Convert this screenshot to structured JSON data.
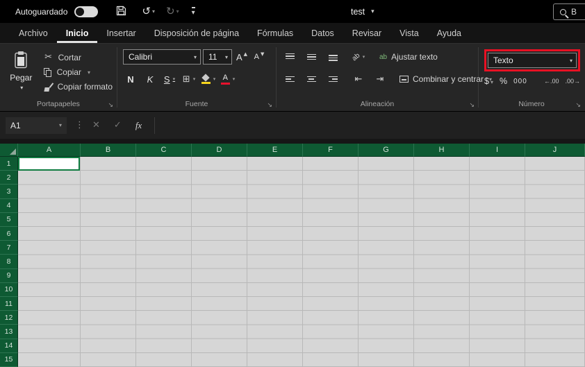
{
  "titlebar": {
    "autosave": "Autoguardado",
    "doc_title": "test",
    "search_hint": "B"
  },
  "tabs": {
    "items": [
      "Archivo",
      "Inicio",
      "Insertar",
      "Disposición de página",
      "Fórmulas",
      "Datos",
      "Revisar",
      "Vista",
      "Ayuda"
    ],
    "active": "Inicio"
  },
  "ribbon": {
    "clipboard": {
      "title": "Portapapeles",
      "paste": "Pegar",
      "cut": "Cortar",
      "copy": "Copiar",
      "format_painter": "Copiar formato"
    },
    "font": {
      "title": "Fuente",
      "name": "Calibri",
      "size": "11",
      "bold": "N",
      "italic": "K",
      "underline": "S"
    },
    "alignment": {
      "title": "Alineación",
      "wrap": "Ajustar texto",
      "wrap_icon": "ab",
      "orientation_icon": "ab",
      "merge": "Combinar y centrar"
    },
    "number": {
      "title": "Número",
      "format": "Texto",
      "currency": "$",
      "percent": "%",
      "thousands": "000",
      "increase_decimals": "←.00",
      "decrease_decimals": ".00→"
    }
  },
  "formula_bar": {
    "name_box": "A1",
    "cancel": "✕",
    "enter": "✓",
    "fx": "fx"
  },
  "grid": {
    "columns": [
      "A",
      "B",
      "C",
      "D",
      "E",
      "F",
      "G",
      "H",
      "I",
      "J"
    ],
    "rows": [
      "1",
      "2",
      "3",
      "4",
      "5",
      "6",
      "7",
      "8",
      "9",
      "10",
      "11",
      "12",
      "13",
      "14",
      "15"
    ],
    "selected_cell": "A1"
  },
  "colors": {
    "highlight_red": "#e81123",
    "header_green": "#0e5a33",
    "selection_green": "#107c41",
    "cell_gray": "#d6d6d6"
  }
}
